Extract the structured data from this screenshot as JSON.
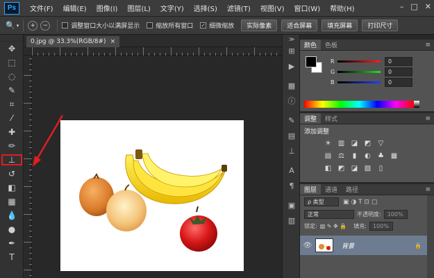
{
  "app": {
    "logo": "Ps"
  },
  "menubar": {
    "items": [
      "文件(F)",
      "编辑(E)",
      "图像(I)",
      "图层(L)",
      "文字(Y)",
      "选择(S)",
      "滤镜(T)",
      "视图(V)",
      "窗口(W)",
      "帮助(H)"
    ],
    "window_controls": [
      "–",
      "□",
      "✕"
    ]
  },
  "options": {
    "tool_glyph": "🔍",
    "zoom_in": "+",
    "zoom_out": "−",
    "checkboxes": [
      {
        "label": "调整窗口大小以满屏显示",
        "checked": false
      },
      {
        "label": "缩放所有窗口",
        "checked": false
      },
      {
        "label": "细微缩放",
        "checked": true
      }
    ],
    "buttons": [
      "实际像素",
      "适合屏幕",
      "填充屏幕",
      "打印尺寸"
    ]
  },
  "document": {
    "tab_title": "0.jpg @ 33.3%(RGB/8#)",
    "close": "×"
  },
  "tools": [
    "move-tool",
    "marquee-tool",
    "lasso-tool",
    "quick-select-tool",
    "crop-tool",
    "eyedropper-tool",
    "healing-brush-tool",
    "brush-tool",
    "clone-stamp-tool",
    "history-brush-tool",
    "eraser-tool",
    "gradient-tool",
    "blur-tool",
    "dodge-tool",
    "pen-tool",
    "type-tool"
  ],
  "tool_glyphs": [
    "✥",
    "⬚",
    "◌",
    "✎",
    "⌗",
    "⁄",
    "✚",
    "✏",
    "⊥",
    "↺",
    "◧",
    "▦",
    "💧",
    "●",
    "✒",
    "T"
  ],
  "active_tool_index": 8,
  "color_panel": {
    "tabs": [
      "颜色",
      "色板"
    ],
    "channels": [
      {
        "label": "R",
        "value": "0",
        "color": "#e02020"
      },
      {
        "label": "G",
        "value": "0",
        "color": "#20c020"
      },
      {
        "label": "B",
        "value": "0",
        "color": "#2040e0"
      }
    ]
  },
  "adjust_panel": {
    "tabs": [
      "调整",
      "样式"
    ],
    "title": "添加调整",
    "row1": [
      "☀",
      "▥",
      "◪",
      "◩",
      "▽"
    ],
    "row2": [
      "▤",
      "⚖",
      "▮",
      "◐",
      "♣",
      "▦"
    ],
    "row3": [
      "◧",
      "◩",
      "◪",
      "▨",
      "▯"
    ]
  },
  "layers_panel": {
    "tabs": [
      "图层",
      "通道",
      "路径"
    ],
    "kind_label": "ρ 类型",
    "blend_mode": "正常",
    "opacity_label": "不透明度:",
    "opacity_value": "100%",
    "lock_label": "锁定:",
    "fill_label": "填充:",
    "fill_value": "100%",
    "layer_name": "背景",
    "lock_glyph": "🔒",
    "eye_glyph": "👁"
  },
  "menu_glyph": "≡",
  "collapse_glyph": "≫"
}
